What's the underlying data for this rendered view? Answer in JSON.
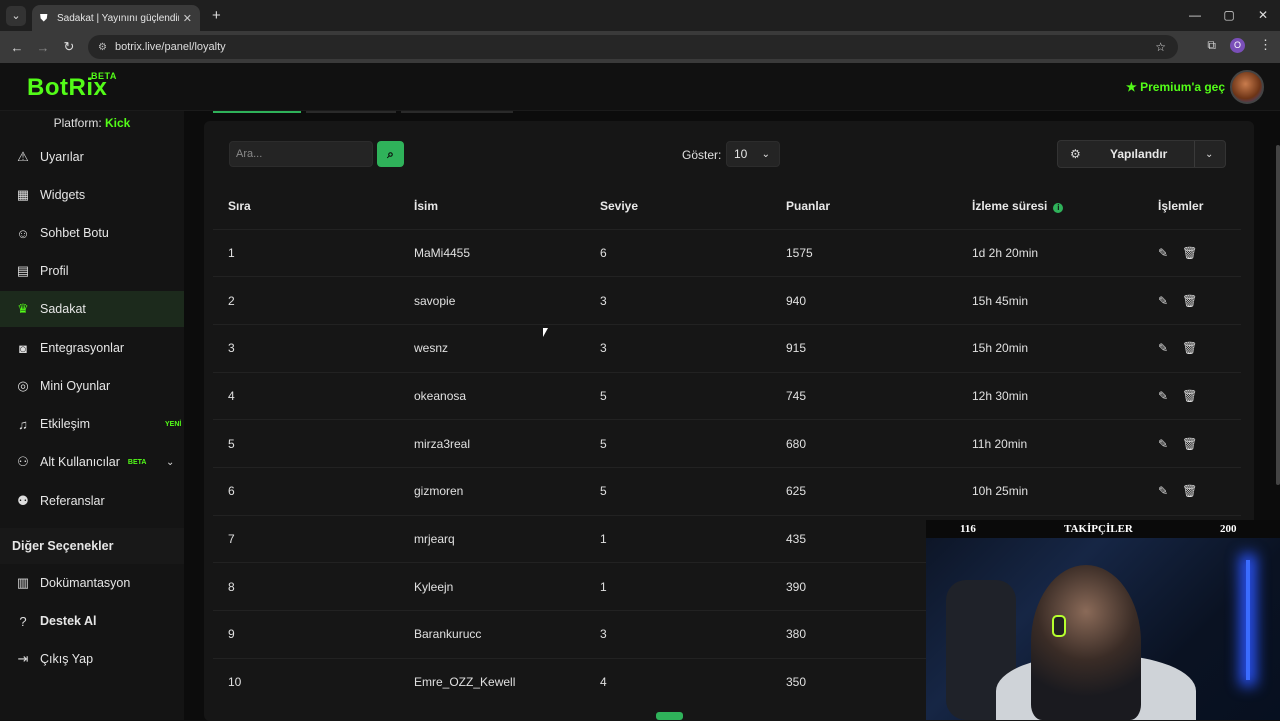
{
  "browser": {
    "tab_title": "Sadakat | Yayınını güçlendirmek",
    "url": "botrix.live/panel/loyalty",
    "profile_initial": "O"
  },
  "header": {
    "logo": "BotRix",
    "logo_badge": "BETA",
    "premium": "Premium'a geç"
  },
  "sidebar": {
    "platform_label": "Platform:",
    "platform_value": "Kick",
    "items": [
      {
        "label": "Uyarılar",
        "icon": "warning-icon"
      },
      {
        "label": "Widgets",
        "icon": "grid-icon"
      },
      {
        "label": "Sohbet Botu",
        "icon": "robot-icon"
      },
      {
        "label": "Profil",
        "icon": "id-card-icon"
      },
      {
        "label": "Sadakat",
        "icon": "trophy-icon",
        "active": true
      },
      {
        "label": "Entegrasyonlar",
        "icon": "discord-icon"
      },
      {
        "label": "Mini Oyunlar",
        "icon": "gamepad-icon"
      },
      {
        "label": "Etkileşim",
        "icon": "music-icon",
        "badge": "YENİ"
      },
      {
        "label": "Alt Kullanıcılar",
        "icon": "users-icon",
        "badge": "BETA"
      },
      {
        "label": "Referanslar",
        "icon": "user-friends-icon"
      }
    ],
    "other_section": "Diğer Seçenekler",
    "other_items": [
      {
        "label": "Dokümantasyon",
        "icon": "book-icon"
      },
      {
        "label": "Destek Al",
        "icon": "question-icon"
      },
      {
        "label": "Çıkış Yap",
        "icon": "logout-icon"
      }
    ]
  },
  "toolbar": {
    "search_placeholder": "Ara...",
    "show_label": "Göster:",
    "show_value": "10",
    "configure_label": "Yapılandır"
  },
  "table": {
    "headers": [
      "Sıra",
      "İsim",
      "Seviye",
      "Puanlar",
      "İzleme süresi",
      "İşlemler"
    ],
    "rows": [
      [
        "1",
        "MaMi4455",
        "6",
        "1575",
        "1d 2h 20min"
      ],
      [
        "2",
        "savopie",
        "3",
        "940",
        "15h 45min"
      ],
      [
        "3",
        "wesnz",
        "3",
        "915",
        "15h 20min"
      ],
      [
        "4",
        "okeanosa",
        "5",
        "745",
        "12h 30min"
      ],
      [
        "5",
        "mirza3real",
        "5",
        "680",
        "11h 20min"
      ],
      [
        "6",
        "gizmoren",
        "5",
        "625",
        "10h 25min"
      ],
      [
        "7",
        "mrjearq",
        "1",
        "435",
        ""
      ],
      [
        "8",
        "Kyleejn",
        "1",
        "390",
        ""
      ],
      [
        "9",
        "Barankurucc",
        "3",
        "380",
        ""
      ],
      [
        "10",
        "Emre_OZZ_Kewell",
        "4",
        "350",
        ""
      ]
    ]
  },
  "webcam": {
    "left_count": "116",
    "title": "TAKİPÇİLER",
    "right_count": "200"
  },
  "colors": {
    "accent": "#53fc18",
    "button_green": "#2fb25a"
  }
}
